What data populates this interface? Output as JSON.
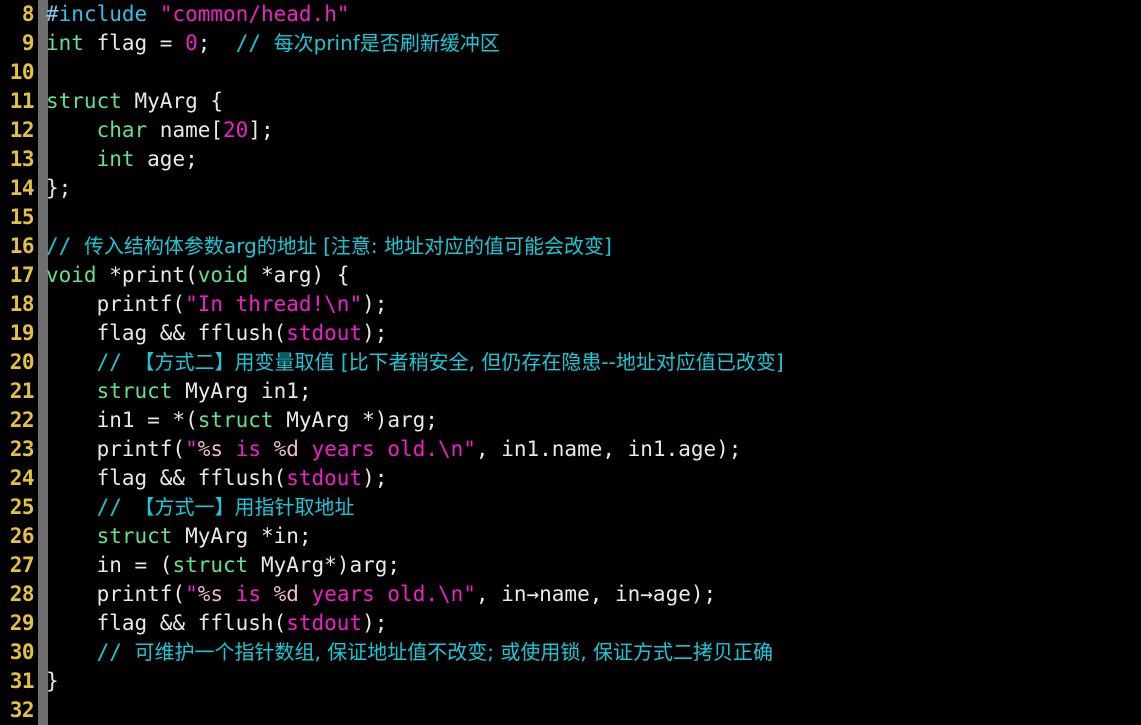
{
  "editor": {
    "name": "code-editor",
    "language": "C",
    "first_line_number": 8,
    "last_line_number": 32,
    "background": "#000000",
    "gutter_color": "#e5c03c",
    "fold_guide_color": "#6e6e6e"
  },
  "colors": {
    "keyword": "#63e08a",
    "preprocessor": "#31c0e8",
    "string": "#f020c8",
    "format_specifier": "#f0b8c8",
    "number": "#f020c8",
    "comment": "#18c8d8",
    "macro": "#f020c8",
    "plain": "#e8e8e8"
  },
  "lines": [
    {
      "number": "8",
      "tokens": [
        {
          "text": "#",
          "cls": "t-hash"
        },
        {
          "text": "include",
          "cls": "t-pre"
        },
        {
          "text": " ",
          "cls": "t-plain"
        },
        {
          "text": "\"common/head.h\"",
          "cls": "t-str"
        }
      ]
    },
    {
      "number": "9",
      "tokens": [
        {
          "text": "int",
          "cls": "t-kw"
        },
        {
          "text": " flag = ",
          "cls": "t-plain"
        },
        {
          "text": "0",
          "cls": "t-num"
        },
        {
          "text": ";  ",
          "cls": "t-plain"
        },
        {
          "text": "// ",
          "cls": "t-cmt"
        },
        {
          "text": "每次prinf是否刷新缓冲区",
          "cls": "t-cmt-cjk"
        }
      ]
    },
    {
      "number": "10",
      "tokens": []
    },
    {
      "number": "11",
      "tokens": [
        {
          "text": "struct",
          "cls": "t-kw"
        },
        {
          "text": " MyArg {",
          "cls": "t-plain"
        }
      ]
    },
    {
      "number": "12",
      "tokens": [
        {
          "text": "    ",
          "cls": "t-plain"
        },
        {
          "text": "char",
          "cls": "t-kw"
        },
        {
          "text": " name[",
          "cls": "t-plain"
        },
        {
          "text": "20",
          "cls": "t-num"
        },
        {
          "text": "];",
          "cls": "t-plain"
        }
      ]
    },
    {
      "number": "13",
      "tokens": [
        {
          "text": "    ",
          "cls": "t-plain"
        },
        {
          "text": "int",
          "cls": "t-kw"
        },
        {
          "text": " age;",
          "cls": "t-plain"
        }
      ]
    },
    {
      "number": "14",
      "tokens": [
        {
          "text": "};",
          "cls": "t-plain"
        }
      ]
    },
    {
      "number": "15",
      "tokens": []
    },
    {
      "number": "16",
      "tokens": [
        {
          "text": "// ",
          "cls": "t-cmt"
        },
        {
          "text": "传入结构体参数arg的地址 [注意: 地址对应的值可能会改变]",
          "cls": "t-cmt-cjk"
        }
      ]
    },
    {
      "number": "17",
      "tokens": [
        {
          "text": "void",
          "cls": "t-kw"
        },
        {
          "text": " *print(",
          "cls": "t-plain"
        },
        {
          "text": "void",
          "cls": "t-kw"
        },
        {
          "text": " *arg) {",
          "cls": "t-plain"
        }
      ]
    },
    {
      "number": "18",
      "tokens": [
        {
          "text": "    printf(",
          "cls": "t-plain"
        },
        {
          "text": "\"In thread!\\n\"",
          "cls": "t-str"
        },
        {
          "text": ");",
          "cls": "t-plain"
        }
      ]
    },
    {
      "number": "19",
      "tokens": [
        {
          "text": "    flag && fflush(",
          "cls": "t-plain"
        },
        {
          "text": "stdout",
          "cls": "t-macro"
        },
        {
          "text": ");",
          "cls": "t-plain"
        }
      ]
    },
    {
      "number": "20",
      "tokens": [
        {
          "text": "    ",
          "cls": "t-plain"
        },
        {
          "text": "// ",
          "cls": "t-cmt"
        },
        {
          "text": "【方式二】用变量取值 [比下者稍安全, 但仍存在隐患--地址对应值已改变]",
          "cls": "t-cmt-cjk"
        }
      ]
    },
    {
      "number": "21",
      "tokens": [
        {
          "text": "    ",
          "cls": "t-plain"
        },
        {
          "text": "struct",
          "cls": "t-kw"
        },
        {
          "text": " MyArg in1;",
          "cls": "t-plain"
        }
      ]
    },
    {
      "number": "22",
      "tokens": [
        {
          "text": "    in1 = *(",
          "cls": "t-plain"
        },
        {
          "text": "struct",
          "cls": "t-kw"
        },
        {
          "text": " MyArg *)arg;",
          "cls": "t-plain"
        }
      ]
    },
    {
      "number": "23",
      "tokens": [
        {
          "text": "    printf(",
          "cls": "t-plain"
        },
        {
          "text": "\"",
          "cls": "t-str"
        },
        {
          "text": "%s",
          "cls": "t-fmt"
        },
        {
          "text": " is ",
          "cls": "t-str"
        },
        {
          "text": "%d",
          "cls": "t-fmt"
        },
        {
          "text": " years old.\\n\"",
          "cls": "t-str"
        },
        {
          "text": ", in1.name, in1.age);",
          "cls": "t-plain"
        }
      ]
    },
    {
      "number": "24",
      "tokens": [
        {
          "text": "    flag && fflush(",
          "cls": "t-plain"
        },
        {
          "text": "stdout",
          "cls": "t-macro"
        },
        {
          "text": ");",
          "cls": "t-plain"
        }
      ]
    },
    {
      "number": "25",
      "tokens": [
        {
          "text": "    ",
          "cls": "t-plain"
        },
        {
          "text": "// ",
          "cls": "t-cmt"
        },
        {
          "text": "【方式一】用指针取地址",
          "cls": "t-cmt-cjk"
        }
      ]
    },
    {
      "number": "26",
      "tokens": [
        {
          "text": "    ",
          "cls": "t-plain"
        },
        {
          "text": "struct",
          "cls": "t-kw"
        },
        {
          "text": " MyArg *in;",
          "cls": "t-plain"
        }
      ]
    },
    {
      "number": "27",
      "tokens": [
        {
          "text": "    in = (",
          "cls": "t-plain"
        },
        {
          "text": "struct",
          "cls": "t-kw"
        },
        {
          "text": " MyArg*)arg;",
          "cls": "t-plain"
        }
      ]
    },
    {
      "number": "28",
      "tokens": [
        {
          "text": "    printf(",
          "cls": "t-plain"
        },
        {
          "text": "\"",
          "cls": "t-str"
        },
        {
          "text": "%s",
          "cls": "t-fmt"
        },
        {
          "text": " is ",
          "cls": "t-str"
        },
        {
          "text": "%d",
          "cls": "t-fmt"
        },
        {
          "text": " years old.\\n\"",
          "cls": "t-str"
        },
        {
          "text": ", in→name, in→age);",
          "cls": "t-plain"
        }
      ]
    },
    {
      "number": "29",
      "tokens": [
        {
          "text": "    flag && fflush(",
          "cls": "t-plain"
        },
        {
          "text": "stdout",
          "cls": "t-macro"
        },
        {
          "text": ");",
          "cls": "t-plain"
        }
      ]
    },
    {
      "number": "30",
      "tokens": [
        {
          "text": "    ",
          "cls": "t-plain"
        },
        {
          "text": "// ",
          "cls": "t-cmt"
        },
        {
          "text": "可维护一个指针数组, 保证地址值不改变; 或使用锁, 保证方式二拷贝正确",
          "cls": "t-cmt-cjk"
        }
      ]
    },
    {
      "number": "31",
      "tokens": [
        {
          "text": "}",
          "cls": "t-plain"
        }
      ]
    },
    {
      "number": "32",
      "tokens": []
    }
  ]
}
